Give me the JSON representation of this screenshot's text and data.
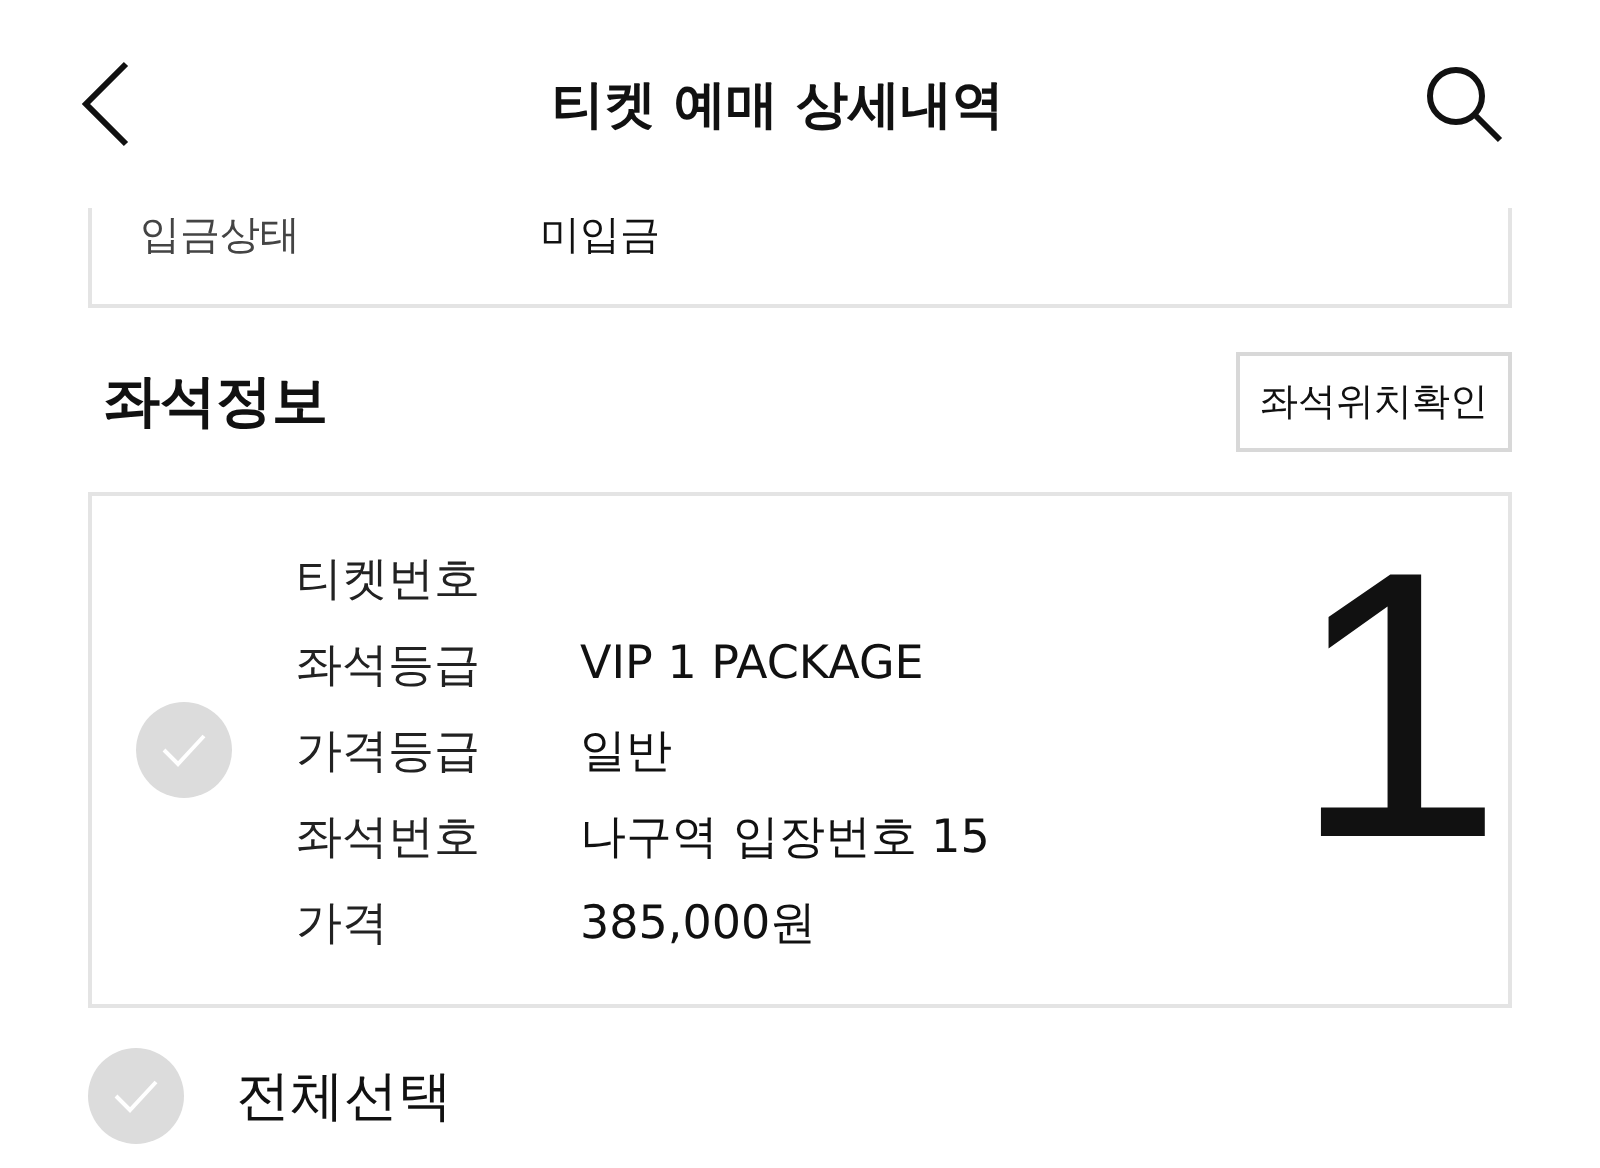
{
  "header": {
    "title": "티켓 예매 상세내역"
  },
  "payment_status": {
    "label": "입금상태",
    "value": "미입금"
  },
  "seat_section": {
    "title": "좌석정보",
    "button": "좌석위치확인"
  },
  "seat_card": {
    "checked": false,
    "rows": [
      {
        "label": "티켓번호"
      },
      {
        "label": "좌석등급",
        "value": "VIP 1 PACKAGE"
      },
      {
        "label": "가격등급",
        "value": "일반"
      },
      {
        "label": "좌석번호",
        "value": "나구역 입장번호 15"
      },
      {
        "label": "가격",
        "value": "385,000원"
      }
    ],
    "annotation": "1"
  },
  "select_all": {
    "label": "전체선택",
    "checked": false
  }
}
